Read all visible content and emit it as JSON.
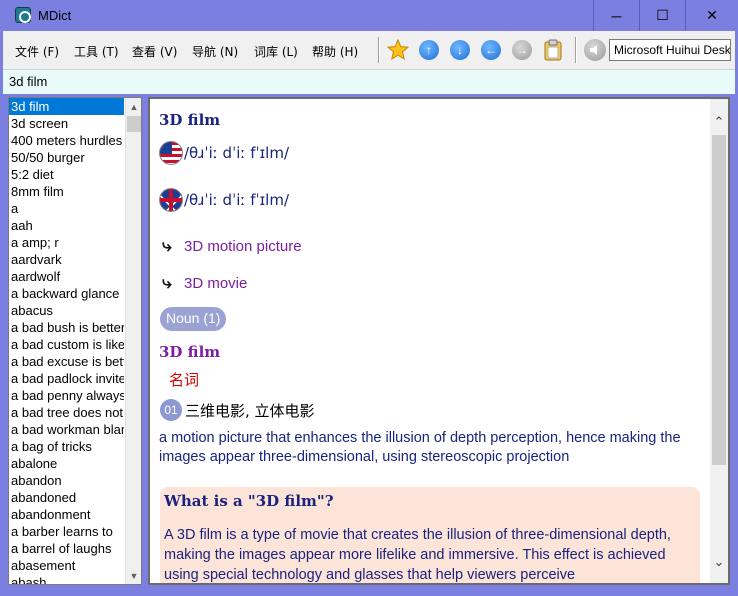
{
  "window": {
    "title": "MDict"
  },
  "controls": {
    "minimize": "─",
    "maximize": "☐",
    "close": "✕"
  },
  "menu": [
    "文件 (F)",
    "工具 (T)",
    "查看 (V)",
    "导航 (N)",
    "词库 (L)",
    "帮助 (H)"
  ],
  "toolbar": {
    "icons": [
      "star-icon",
      "arrow-up-icon",
      "arrow-down-icon",
      "arrow-left-icon",
      "arrow-right-icon",
      "clipboard-icon",
      "speaker-icon"
    ],
    "voice": "Microsoft Huihui Desktop"
  },
  "search": {
    "value": "3d film"
  },
  "wordlist": [
    "3d film",
    "3d screen",
    "400 meters hurdles",
    "50/50 burger",
    "5:2 diet",
    "8mm film",
    "a",
    "aah",
    "a amp; r",
    "aardvark",
    "aardwolf",
    "a backward glance",
    "abacus",
    "a bad bush is better",
    "a bad custom is like",
    "a bad excuse is better",
    "a bad padlock invites",
    "a bad penny always",
    "a bad tree does not",
    "a bad workman blames",
    "a bag of tricks",
    "abalone",
    "abandon",
    "abandoned",
    "abandonment",
    "a barber learns to",
    "a barrel of laughs",
    "abasement",
    "abash"
  ],
  "entry": {
    "headword": "3D film",
    "pron_us": "/θɹˈiː dˈiː fˈɪlm/",
    "pron_uk": "/θɹˈiː dˈiː fˈɪlm/",
    "synonyms": [
      "3D motion picture",
      "3D movie"
    ],
    "pos_badge": "Noun (1)",
    "headword2": "3D film",
    "pos_cn": "名词",
    "sense_num": "01",
    "sense_cn": "三维电影, 立体电影",
    "sense_def": "a motion picture that enhances the illusion of depth perception, hence making the images appear three-dimensional, using stereoscopic projection",
    "faq_title": "What is a \"3D film\"?",
    "faq_body": "A 3D film is a type of movie that creates the illusion of three-dimensional depth, making the images appear more lifelike and immersive. This effect is achieved using special technology and glasses that help viewers perceive"
  }
}
